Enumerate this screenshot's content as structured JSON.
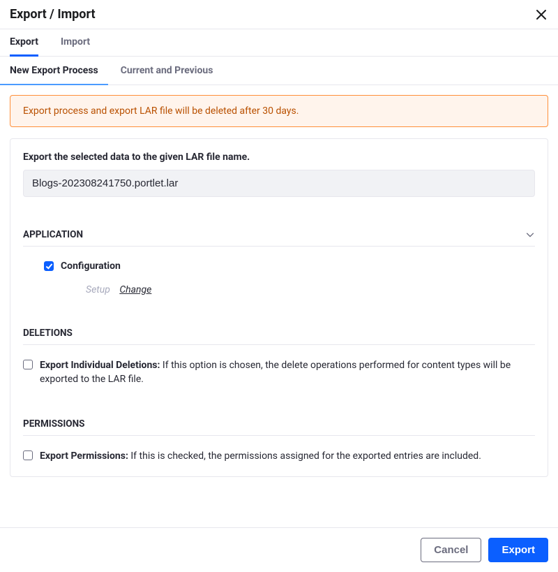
{
  "header": {
    "title": "Export / Import"
  },
  "tabs_primary": {
    "items": [
      {
        "label": "Export"
      },
      {
        "label": "Import"
      }
    ]
  },
  "tabs_secondary": {
    "items": [
      {
        "label": "New Export Process"
      },
      {
        "label": "Current and Previous"
      }
    ]
  },
  "alert": {
    "message": "Export process and export LAR file will be deleted after 30 days."
  },
  "form": {
    "prompt": "Export the selected data to the given LAR file name.",
    "filename": "Blogs-202308241750.portlet.lar"
  },
  "application": {
    "heading": "APPLICATION",
    "configuration_label": "Configuration",
    "setup_label": "Setup",
    "change_label": "Change"
  },
  "deletions": {
    "heading": "DELETIONS",
    "checkbox_label": "Export Individual Deletions:",
    "description": "If this option is chosen, the delete operations performed for content types will be exported to the LAR file."
  },
  "permissions": {
    "heading": "PERMISSIONS",
    "checkbox_label": "Export Permissions:",
    "description": "If this is checked, the permissions assigned for the exported entries are included."
  },
  "footer": {
    "cancel": "Cancel",
    "export": "Export"
  }
}
